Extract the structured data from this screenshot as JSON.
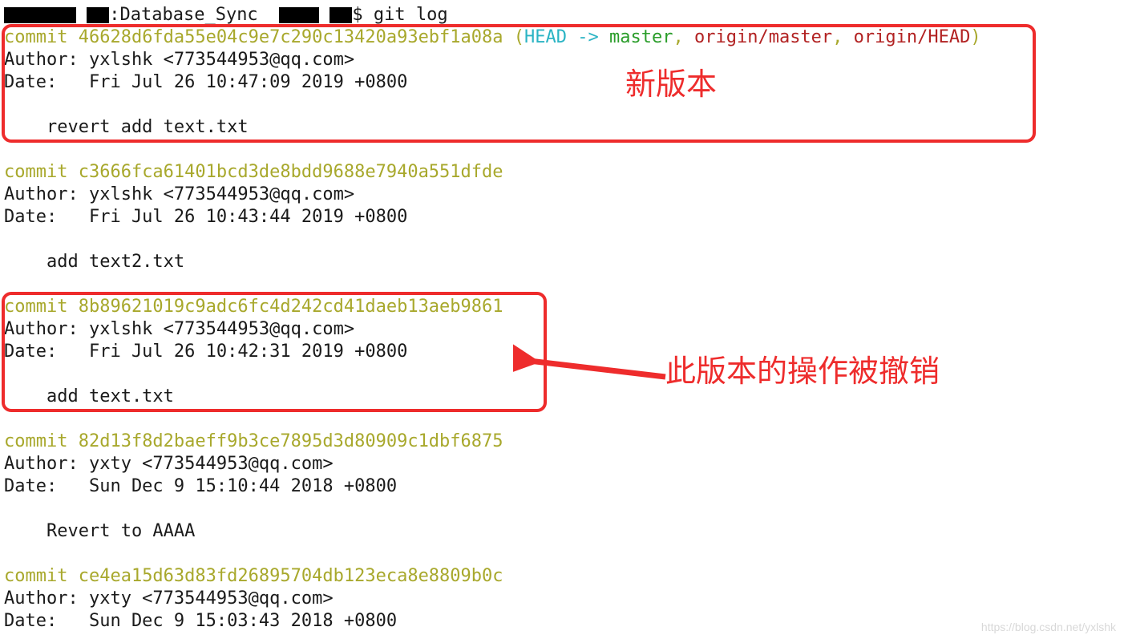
{
  "prompt": {
    "mid": ":Database_Sync  ",
    "end": "$ git log"
  },
  "commits": [
    {
      "hash": "46628d6fda55e04c9e7c290c13420a93ebf1a08a",
      "refs": {
        "head": "HEAD",
        "arrow": " -> ",
        "branch": "master",
        "remote1": "origin/master",
        "remote2": "origin/HEAD"
      },
      "author": "Author: yxlshk <773544953@qq.com>",
      "date": "Date:   Fri Jul 26 10:47:09 2019 +0800",
      "message": "    revert add text.txt"
    },
    {
      "hash": "c3666fca61401bcd3de8bdd9688e7940a551dfde",
      "author": "Author: yxlshk <773544953@qq.com>",
      "date": "Date:   Fri Jul 26 10:43:44 2019 +0800",
      "message": "    add text2.txt"
    },
    {
      "hash": "8b89621019c9adc6fc4d242cd41daeb13aeb9861",
      "author": "Author: yxlshk <773544953@qq.com>",
      "date": "Date:   Fri Jul 26 10:42:31 2019 +0800",
      "message": "    add text.txt"
    },
    {
      "hash": "82d13f8d2baeff9b3ce7895d3d80909c1dbf6875",
      "author": "Author: yxty <773544953@qq.com>",
      "date": "Date:   Sun Dec 9 15:10:44 2018 +0800",
      "message": "    Revert to AAAA"
    },
    {
      "hash": "ce4ea15d63d83fd26895704db123eca8e8809b0c",
      "author": "Author: yxty <773544953@qq.com>",
      "date": "Date:   Sun Dec 9 15:03:43 2018 +0800",
      "message": ""
    }
  ],
  "annotations": {
    "new_version": "新版本",
    "reverted": "此版本的操作被撤销"
  },
  "commit_prefix": "commit ",
  "watermark": "https://blog.csdn.net/yxlshk"
}
